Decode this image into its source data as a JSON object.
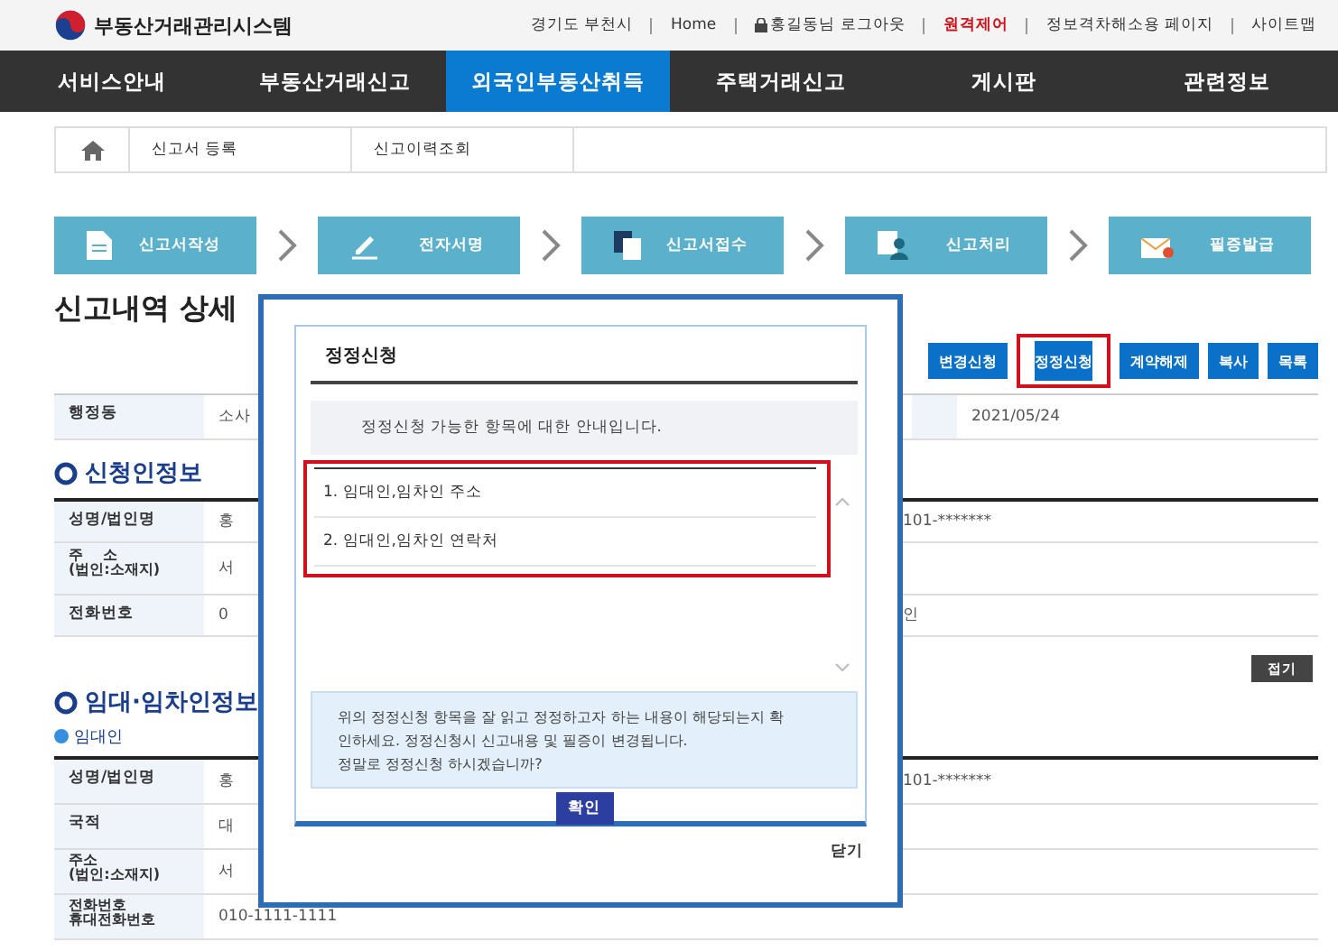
{
  "header": {
    "logo": "부동산거래관리시스템",
    "links": [
      {
        "text": "경기도 부천시",
        "kind": "plain"
      },
      {
        "text": "Home",
        "kind": "plain"
      },
      {
        "text": "홍길동님 로그아웃",
        "kind": "lock"
      },
      {
        "text": "원격제어",
        "kind": "alert"
      },
      {
        "text": "정보격차해소용 페이지",
        "kind": "plain"
      },
      {
        "text": "사이트맵",
        "kind": "plain"
      }
    ]
  },
  "nav": [
    {
      "label": "서비스안내",
      "selected": false
    },
    {
      "label": "부동산거래신고",
      "selected": false
    },
    {
      "label": "외국인부동산취득",
      "selected": true
    },
    {
      "label": "주택거래신고",
      "selected": false
    },
    {
      "label": "게시판",
      "selected": false
    },
    {
      "label": "관련정보",
      "selected": false
    }
  ],
  "breadcrumb": [
    "신고서 등록",
    "신고이력조회"
  ],
  "steps": [
    {
      "label": "신고서작성",
      "kind": "document"
    },
    {
      "label": "전자서명",
      "kind": "pen"
    },
    {
      "label": "신고서접수",
      "kind": "copies"
    },
    {
      "label": "신고처리",
      "kind": "person"
    },
    {
      "label": "필증발급",
      "kind": "mail"
    }
  ],
  "page_title": "신고내역 상세",
  "actions": [
    {
      "label": "변경신청",
      "highlighted": false
    },
    {
      "label": "정정신청",
      "highlighted": true
    },
    {
      "label": "계약해제",
      "highlighted": false
    },
    {
      "label": "복사",
      "highlighted": false
    },
    {
      "label": "목록",
      "highlighted": false
    }
  ],
  "summary": {
    "label": "행정동",
    "value": "소사",
    "date": "2021/05/24"
  },
  "applicant": {
    "title": "신청인정보",
    "rows": [
      {
        "label": [
          "성명/법인명"
        ],
        "value": "홍",
        "right": "101-*******"
      },
      {
        "label": [
          "주    소",
          "(법인:소재지)"
        ],
        "value": "서",
        "right": ""
      },
      {
        "label": [
          "전화번호"
        ],
        "value": "0",
        "right": "인"
      }
    ]
  },
  "collapse_button": "접기",
  "parties": {
    "title": "임대·임차인정보",
    "subtitle": "임대인",
    "rows": [
      {
        "label": [
          "성명/법인명"
        ],
        "value": "홍",
        "right": "101-*******"
      },
      {
        "label": [
          "국적"
        ],
        "value": "대",
        "right": ""
      },
      {
        "label": [
          "주소",
          "(법인:소재지)"
        ],
        "value": "서",
        "right": ""
      },
      {
        "label": [
          "전화번호",
          "휴대전화번호"
        ],
        "value": "010-1111-1111",
        "right": ""
      }
    ]
  },
  "dialog": {
    "title": "정정신청",
    "intro": "정정신청 가능한 항목에 대한 안내입니다.",
    "list": {
      "highlighted": true,
      "items": [
        "1. 임대인,임차인 주소",
        "2. 임대인,임차인 연락처"
      ]
    },
    "notice": [
      "위의 정정신청 항목을 잘 읽고 정정하고자 하는 내용이 해당되는지 확",
      "인하세요. 정정신청시 신고내용 및 필증이 변경됩니다.",
      "정말로 정정신청 하시겠습니까?"
    ],
    "confirm": "확인",
    "close": "닫기"
  }
}
